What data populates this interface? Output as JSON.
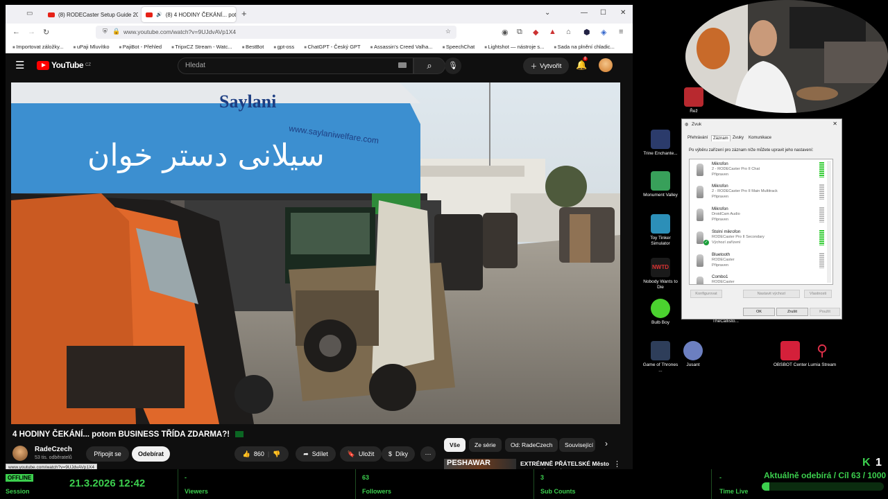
{
  "browser": {
    "tabs": [
      {
        "label": "(8) RODECaster Setup Guide 20"
      },
      {
        "label": "(8) 4 HODINY ČEKÁNÍ... pot"
      }
    ],
    "url": "www.youtube.com/watch?v=9UJdvAVp1X4",
    "bookmarks": [
      "Importovat záložky...",
      "uPaji Mluvítko",
      "PajiBot - Přehled",
      "TripxCZ Stream - Watc...",
      "BestBot",
      "gpt-oss",
      "ChatGPT - Český GPT",
      "Assassin's Creed Valha...",
      "SpeechChat",
      "Lightshot — nástroje s...",
      "Sada na plnění chladic..."
    ]
  },
  "youtube": {
    "logo": "YouTube",
    "country": "CZ",
    "search_placeholder": "Hledat",
    "create_label": "Vytvořit",
    "notif_count": "8",
    "video_title": "4 HODINY ČEKÁNÍ... potom BUSINESS TŘÍDA ZDARMA?!",
    "channel_name": "RadeCzech",
    "subscribers": "53 tis. odběratelů",
    "join_label": "Připojit se",
    "subscribe_label": "Odebírat",
    "likes": "860",
    "share_label": "Sdílet",
    "save_label": "Uložit",
    "thanks_label": "Díky",
    "chips": [
      "Vše",
      "Ze série",
      "Od: RadeCzech",
      "Související"
    ],
    "reco_thumb_text": "PESHAWAR",
    "reco_title": "EXTRÉMNĚ PŘÁTELSKÉ Město v AFGHÁNSKÝCH Horách |",
    "status_url": "www.youtube.com/watch?v=9UJdvAVp1X4",
    "sign_text_urdu": "سیلانی دستر خوان",
    "sign_brand": "Saylani",
    "sign_url": "www.saylaniwelfare.com"
  },
  "desktop_icons": [
    {
      "label": "Řež",
      "color": "#b8292f"
    },
    {
      "label": "Trine Enchante...",
      "color": "#2b3b6b"
    },
    {
      "label": "Monument Valley",
      "color": "#38a05a"
    },
    {
      "label": "Toy Tinker Simulator",
      "color": "#2c8fb8"
    },
    {
      "label": "Nobody Wants to Die",
      "color": "#1a1a1a"
    },
    {
      "label": "Bulb Boy",
      "color": "#4bd12f"
    },
    {
      "label": "TheCallisto...",
      "color": "#111111"
    },
    {
      "label": "Game of Thrones ...",
      "color": "#2e3e5a"
    },
    {
      "label": "Jusant",
      "color": "#6c7fc0"
    },
    {
      "label": "OBSBOT Center",
      "color": "#d4203a"
    },
    {
      "label": "Lumia Stream",
      "color": "#e0304a"
    }
  ],
  "sound_dialog": {
    "title": "Zvuk",
    "tabs": [
      "Přehrávání",
      "Záznam",
      "Zvuky",
      "Komunikace"
    ],
    "description": "Po výběru zařízení pro záznam níže můžete upravit jeho nastavení:",
    "devices": [
      {
        "name": "Mikrofon",
        "detail": "2 - RODECaster Pro II Chat",
        "status": "Připraven"
      },
      {
        "name": "Mikrofon",
        "detail": "2 - RODECaster Pro II Main Multitrack",
        "status": "Připraven"
      },
      {
        "name": "Mikrofon",
        "detail": "DroidCam Audio",
        "status": "Připraven"
      },
      {
        "name": "Stolní mikrofon",
        "detail": "RODECaster Pro II Secondary",
        "status": "Výchozí zařízení"
      },
      {
        "name": "Bluetooth",
        "detail": "RODECaster",
        "status": "Připraven"
      },
      {
        "name": "Combo1",
        "detail": "RODECaster",
        "status": ""
      }
    ],
    "configure_label": "Konfigurovat",
    "set_default_label": "Nastavit výchozí",
    "properties_label": "Vlastnosti",
    "ok_label": "OK",
    "cancel_label": "Zrušit",
    "apply_label": "Použít"
  },
  "stream_bar": {
    "status": "OFFLINE",
    "session_label": "Session",
    "datetime": "21.3.2026 12:42",
    "viewers_value": "-",
    "viewers_label": "Viewers",
    "followers_value": "63",
    "followers_label": "Followers",
    "subs_value": "3",
    "subs_label": "Sub Counts",
    "timelive_value": "-",
    "timelive_label": "Time Live",
    "goal_text": "Aktuálně odebírá / Cíl  63 / 1000",
    "goal_fraction": 0.063,
    "kick_logo": "K",
    "kick_count": "1",
    "accent": "#3ccf4e"
  }
}
